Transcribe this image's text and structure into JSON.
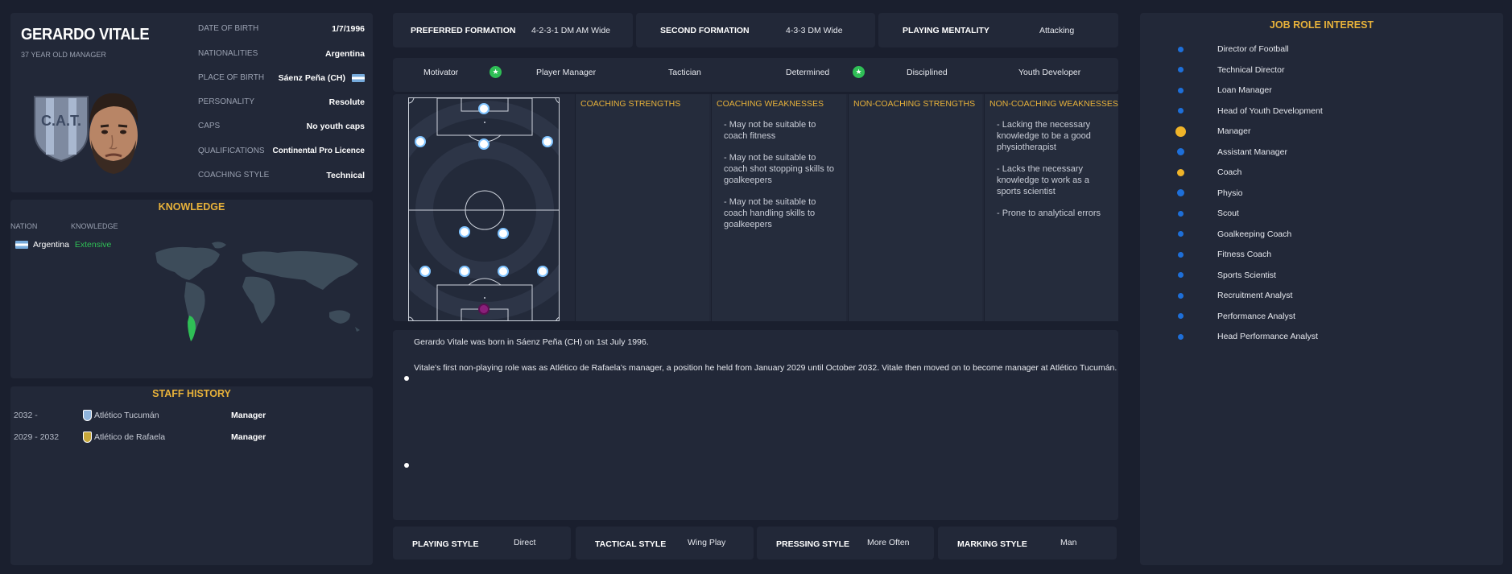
{
  "manager": {
    "name": "GERARDO VITALE",
    "age_label": "37 YEAR OLD MANAGER",
    "details": [
      {
        "label": "DATE OF BIRTH",
        "value": "1/7/1996"
      },
      {
        "label": "NATIONALITIES",
        "value": "Argentina"
      },
      {
        "label": "PLACE OF BIRTH",
        "value": "Sáenz Peña (CH)"
      },
      {
        "label": "PERSONALITY",
        "value": "Resolute"
      },
      {
        "label": "CAPS",
        "value": "No youth caps"
      },
      {
        "label": "QUALIFICATIONS",
        "value": "Continental Pro Licence"
      },
      {
        "label": "COACHING STYLE",
        "value": "Technical"
      }
    ],
    "crest_text": "C.A.T."
  },
  "knowledge": {
    "title": "KNOWLEDGE",
    "col_nation": "NATION",
    "col_knowledge": "KNOWLEDGE",
    "rows": [
      {
        "nation": "Argentina",
        "level": "Extensive"
      }
    ]
  },
  "history": {
    "title": "STAFF HISTORY",
    "rows": [
      {
        "years": "2032 -",
        "club": "Atlético Tucumán",
        "role": "Manager"
      },
      {
        "years": "2029 - 2032",
        "club": "Atlético de Rafaela",
        "role": "Manager"
      }
    ]
  },
  "formations": [
    {
      "label": "PREFERRED FORMATION",
      "value": "4-2-3-1 DM AM Wide"
    },
    {
      "label": "SECOND FORMATION",
      "value": "4-3-3 DM Wide"
    },
    {
      "label": "PLAYING MENTALITY",
      "value": "Attacking"
    }
  ],
  "attributes": [
    "Motivator",
    "Player Manager",
    "Tactician",
    "Determined",
    "Disciplined",
    "Youth Developer"
  ],
  "columns": {
    "coaching_strengths": {
      "title": "COACHING STRENGTHS",
      "items": []
    },
    "coaching_weaknesses": {
      "title": "COACHING WEAKNESSES",
      "items": [
        "- May not be suitable to coach fitness",
        "- May not be suitable to coach shot stopping skills to goalkeepers",
        "- May not be suitable to coach handling skills to goalkeepers"
      ]
    },
    "non_coaching_strengths": {
      "title": "NON-COACHING STRENGTHS",
      "items": []
    },
    "non_coaching_weaknesses": {
      "title": "NON-COACHING WEAKNESSES",
      "items": [
        "- Lacking the necessary knowledge to be a good physiotherapist",
        "- Lacks the necessary knowledge to work as a sports scientist",
        "- Prone to analytical errors"
      ]
    }
  },
  "bio": {
    "line1": "Gerardo Vitale was born in Sáenz Peña (CH) on 1st July 1996.",
    "line2": "Vitale's first non-playing role was as Atlético de Rafaela's manager, a position he held from January 2029 until October 2032. Vitale then moved on to become manager at Atlético Tucumán."
  },
  "styles": [
    {
      "label": "PLAYING STYLE",
      "value": "Direct"
    },
    {
      "label": "TACTICAL STYLE",
      "value": "Wing Play"
    },
    {
      "label": "PRESSING STYLE",
      "value": "More Often"
    },
    {
      "label": "MARKING STYLE",
      "value": "Man"
    }
  ],
  "jobs": {
    "title": "JOB ROLE INTEREST",
    "items": [
      {
        "name": "Director of Football",
        "level": "low"
      },
      {
        "name": "Technical Director",
        "level": "low"
      },
      {
        "name": "Loan Manager",
        "level": "low"
      },
      {
        "name": "Head of Youth Development",
        "level": "low"
      },
      {
        "name": "Manager",
        "level": "high"
      },
      {
        "name": "Assistant Manager",
        "level": "medium"
      },
      {
        "name": "Coach",
        "level": "high-small"
      },
      {
        "name": "Physio",
        "level": "medium"
      },
      {
        "name": "Scout",
        "level": "low"
      },
      {
        "name": "Goalkeeping Coach",
        "level": "low"
      },
      {
        "name": "Fitness Coach",
        "level": "low"
      },
      {
        "name": "Sports Scientist",
        "level": "low"
      },
      {
        "name": "Recruitment Analyst",
        "level": "low"
      },
      {
        "name": "Performance Analyst",
        "level": "low"
      },
      {
        "name": "Head Performance Analyst",
        "level": "low"
      }
    ]
  },
  "colors": {
    "accent": "#e8b23a",
    "background": "#1a1f2e",
    "panel": "#222838",
    "dot_blue": "#1e6fd9",
    "dot_gold": "#f0b429",
    "star_green": "#2fbf56"
  }
}
